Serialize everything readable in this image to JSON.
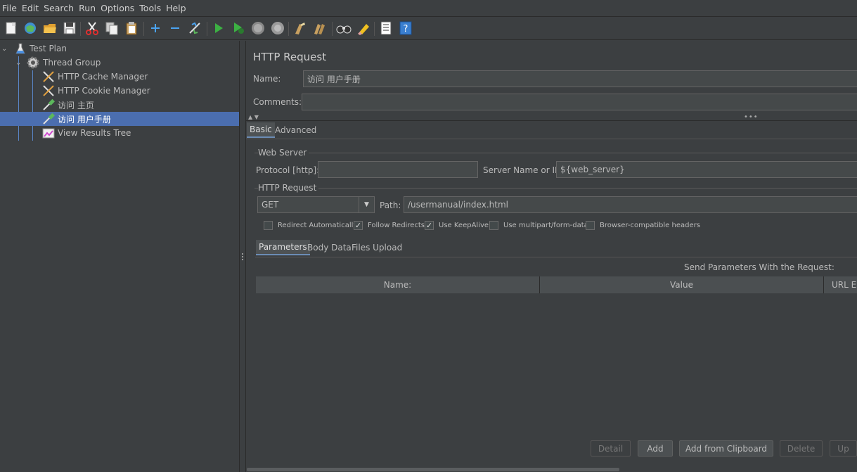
{
  "menu": {
    "file": "File",
    "edit": "Edit",
    "search": "Search",
    "run": "Run",
    "options": "Options",
    "tools": "Tools",
    "help": "Help"
  },
  "toolbar_icons": [
    "new-icon",
    "templates-icon",
    "open-icon",
    "save-icon",
    "cut-icon",
    "copy-icon",
    "paste-icon",
    "expand-icon",
    "collapse-icon",
    "toggle-icon",
    "start-icon",
    "start-no-pauses-icon",
    "stop-icon",
    "shutdown-icon",
    "clear-icon",
    "clear-all-icon",
    "search-icon",
    "reset-search-icon",
    "function-helper-icon",
    "help-icon"
  ],
  "tree": {
    "test_plan": "Test Plan",
    "thread_group": "Thread Group",
    "cache_manager": "HTTP Cache Manager",
    "cookie_manager": "HTTP Cookie Manager",
    "visit_home": "访问 主页",
    "visit_manual": "访问 用户手册",
    "results_tree": "View Results Tree"
  },
  "panel": {
    "title": "HTTP Request",
    "name_label": "Name:",
    "name_value": "访问 用户手册",
    "comments_label": "Comments:",
    "comments_value": "",
    "tabs": [
      "Basic",
      "Advanced"
    ],
    "web_server_title": "Web Server",
    "protocol_label": "Protocol [http]:",
    "protocol_value": "",
    "server_label": "Server Name or IP:",
    "server_value": "${web_server}",
    "http_request_title": "HTTP Request",
    "method_value": "GET",
    "path_label": "Path:",
    "path_value": "/usermanual/index.html",
    "checkboxes": [
      {
        "label": "Redirect Automatically",
        "checked": false
      },
      {
        "label": "Follow Redirects",
        "checked": true
      },
      {
        "label": "Use KeepAlive",
        "checked": true
      },
      {
        "label": "Use multipart/form-data",
        "checked": false
      },
      {
        "label": "Browser-compatible headers",
        "checked": false
      }
    ],
    "sub_tabs": [
      "Parameters",
      "Body Data",
      "Files Upload"
    ],
    "send_params_label": "Send Parameters With the Request:",
    "columns": [
      "Name:",
      "Value",
      "URL En"
    ],
    "buttons": {
      "detail": "Detail",
      "add": "Add",
      "add_clipboard": "Add from Clipboard",
      "delete": "Delete",
      "up": "Up"
    }
  },
  "colors": {
    "background": "#3c3f41",
    "selection": "#4b6eaf",
    "field": "#45494a",
    "text": "#bbbbbb"
  }
}
